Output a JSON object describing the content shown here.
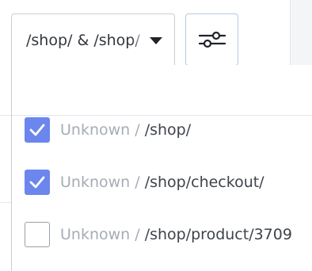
{
  "filter": {
    "selected_value": "/shop/ & /shop/",
    "caret_icon": "caret-down-icon",
    "settings_icon": "sliders-icon"
  },
  "options": [
    {
      "prefix": "Unknown / ",
      "path": "/shop/",
      "checked": true
    },
    {
      "prefix": "Unknown / ",
      "path": "/shop/checkout/",
      "checked": true
    },
    {
      "prefix": "Unknown / ",
      "path": "/shop/product/3709",
      "checked": false
    }
  ],
  "colors": {
    "accent": "#6b86ec",
    "muted_text": "#a6acb6",
    "text": "#3e434b",
    "border": "#c9ced6"
  }
}
